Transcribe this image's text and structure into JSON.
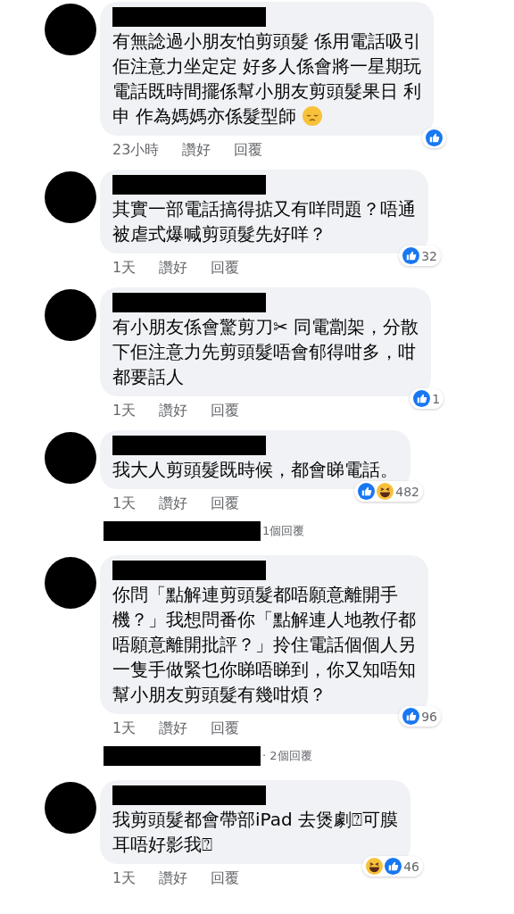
{
  "thread": [
    {
      "kind": "comment",
      "lines": [
        "有無諗過小朋友怕剪頭髮 係用電話吸引",
        "佢注意力坐定定 好多人係會將一星期玩",
        "電話既時間擺係幫小朋友剪頭髮果日 利",
        "申 作為媽媽亦係髮型師"
      ],
      "emoji": {
        "kind": "pensive"
      },
      "time": "23小時",
      "like": "讚好",
      "reply": "回覆",
      "reactions": [
        {
          "kind": "like"
        }
      ]
    },
    {
      "kind": "comment",
      "lines": [
        "其實一部電話搞得掂又有咩問題？唔通",
        "被虐式爆喊剪頭髮先好咩？"
      ],
      "time": "1天",
      "like": "讚好",
      "reply": "回覆",
      "reactions": [
        {
          "kind": "like"
        }
      ],
      "count": "32"
    },
    {
      "kind": "comment",
      "lines": [
        "有小朋友係會驚剪刀✂ 同電劏架，分散",
        "下佢注意力先剪頭髮唔會郁得咁多，咁",
        "都要話人"
      ],
      "time": "1天",
      "like": "讚好",
      "reply": "回覆",
      "reactions": [
        {
          "kind": "like"
        }
      ],
      "count": "1"
    },
    {
      "kind": "comment",
      "lines": [
        "我大人剪頭髮既時候，都會睇電話。"
      ],
      "time": "1天",
      "like": "讚好",
      "reply": "回覆",
      "reactions": [
        {
          "kind": "like"
        },
        {
          "kind": "haha"
        }
      ],
      "count": "482"
    },
    {
      "kind": "replies",
      "label": "1個回覆"
    },
    {
      "kind": "comment",
      "lines": [
        "你問「點解連剪頭髮都唔願意離開手",
        "機？」我想問番你「點解連人地教仔都",
        "唔願意離開批評？」拎住電話個個人另",
        "一隻手做緊乜你睇唔睇到，你又知唔知",
        "幫小朋友剪頭髮有幾咁煩？"
      ],
      "time": "1天",
      "like": "讚好",
      "reply": "回覆",
      "reactions": [
        {
          "kind": "like"
        }
      ],
      "count": "96"
    },
    {
      "kind": "replies",
      "label": "· 2個回覆"
    },
    {
      "kind": "comment",
      "lines": [
        "我剪頭髮都會帶部iPad 去煲劇⍰可膜",
        "耳唔好影我⍰"
      ],
      "time": "1天",
      "like": "讚好",
      "reply": "回覆",
      "reactions": [
        {
          "kind": "haha"
        },
        {
          "kind": "like"
        }
      ],
      "count": "46"
    }
  ]
}
